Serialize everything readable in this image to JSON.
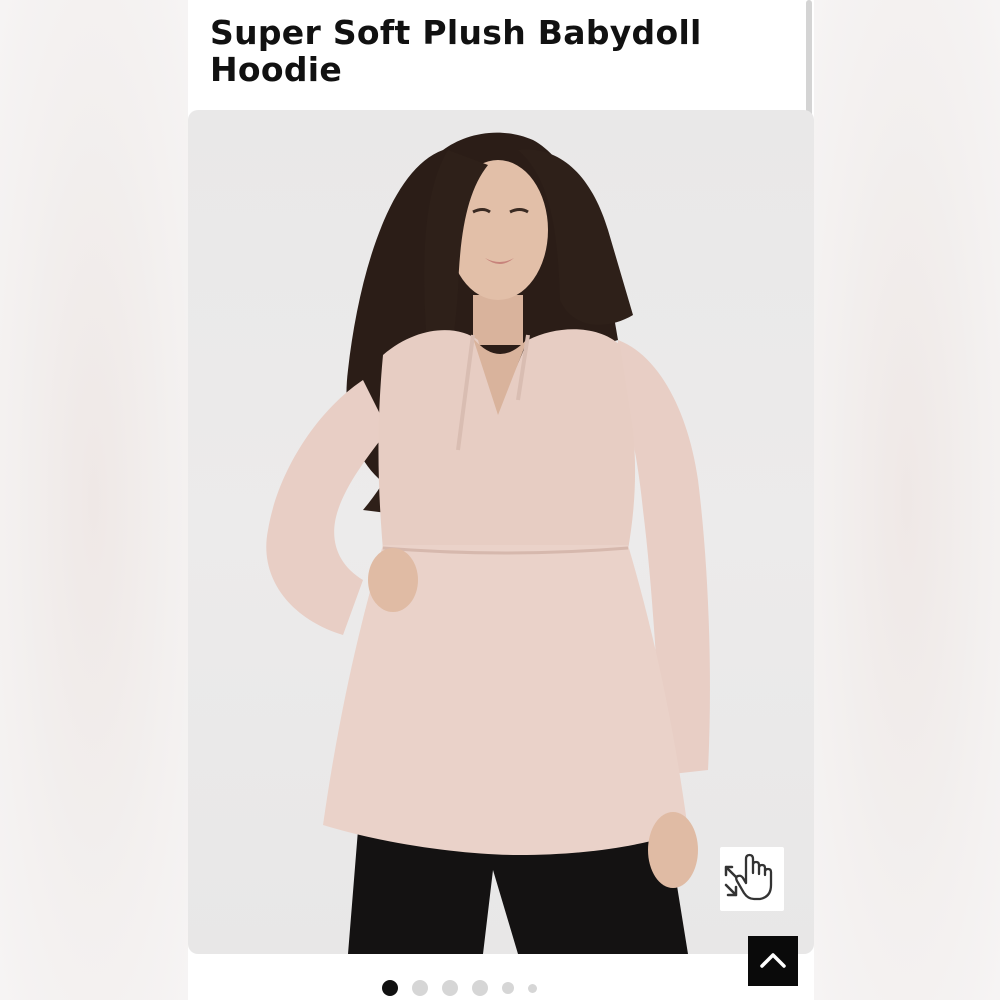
{
  "product": {
    "title": "Super Soft Plush Babydoll Hoodie",
    "image_alt": "Model wearing blush pink babydoll hoodie with black pants"
  },
  "carousel": {
    "total": 6,
    "active_index": 0
  },
  "controls": {
    "zoom_icon": "pinch-zoom-hand-icon",
    "back_to_top_icon": "chevron-up-icon"
  },
  "colors": {
    "garment": "#e9cfc6",
    "accent": "#111111",
    "background": "#ebeaea"
  }
}
